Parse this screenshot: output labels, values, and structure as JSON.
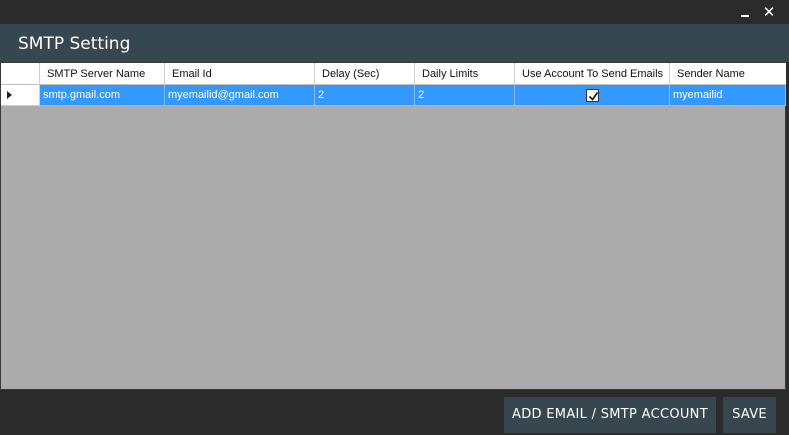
{
  "window": {
    "minimize_icon": "minimize-icon",
    "close_symbol": "✕"
  },
  "header": {
    "title": "SMTP Setting"
  },
  "grid": {
    "columns": [
      "SMTP Server Name",
      "Email Id",
      "Delay (Sec)",
      "Daily Limits",
      "Use Account To Send Emails",
      "Sender Name"
    ],
    "rows": [
      {
        "smtp_server": "smtp.gmail.com",
        "email": "myemailid@gmail.com",
        "delay": "2",
        "daily_limit": "2",
        "use_account": true,
        "sender_name": "myemailid"
      }
    ]
  },
  "footer": {
    "add_label": "ADD  EMAIL / SMTP ACCOUNT",
    "save_label": "SAVE"
  },
  "colors": {
    "header_bg": "#37474f",
    "selection": "#3399ff",
    "grid_bg": "#ababab",
    "window_bg": "#2b2b2b"
  }
}
